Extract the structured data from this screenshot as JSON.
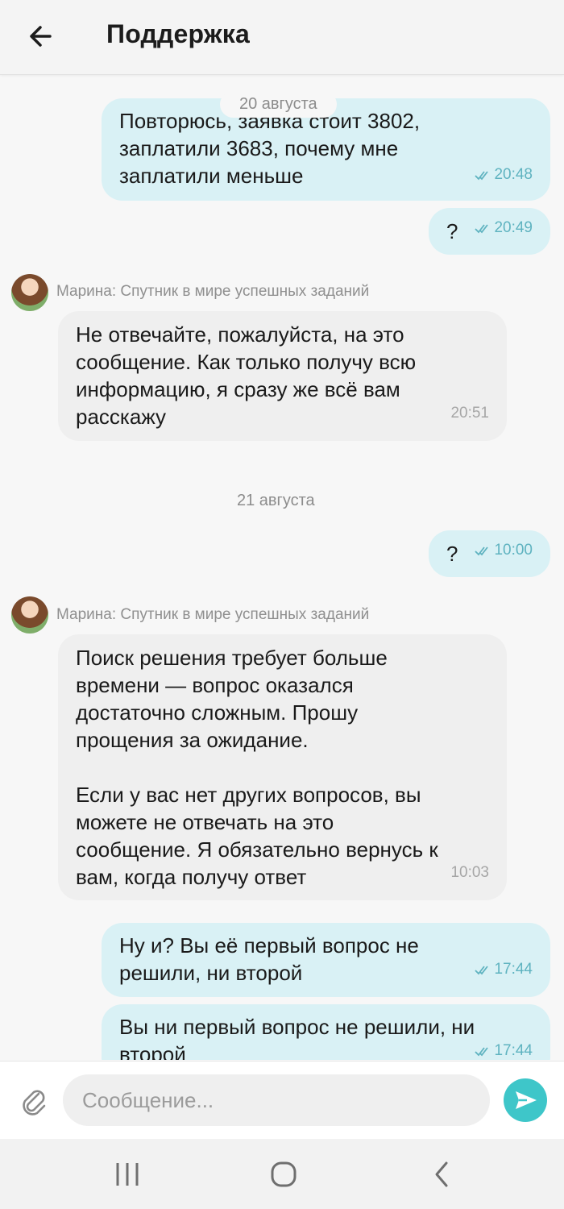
{
  "header": {
    "title": "Поддержка",
    "back_icon": "arrow-left-icon"
  },
  "messages": [
    {
      "dir": "out",
      "text": "Повторюсь, заявка стоит 3802,\nзаплатили 3683, почему мне\nзаплатили меньше",
      "time": "20:48"
    },
    {
      "dir": "out",
      "text": "?",
      "time": "20:49"
    },
    {
      "dir": "in",
      "sender": "Марина: Спутник в мире успешных заданий",
      "text": "Не отвечайте, пожалуйста, на это\nсообщение. Как только получу всю\nинформацию, я сразу же всё вам\nрасскажу",
      "time": "20:51"
    },
    {
      "dir": "out",
      "text": "?",
      "time": "10:00"
    },
    {
      "dir": "in",
      "sender": "Марина: Спутник в мире успешных заданий",
      "text": "Поиск решения требует больше\nвремени — вопрос оказался\nдостаточно сложным. Прошу\nпрощения за ожидание.\n\nЕсли у вас нет других вопросов, вы\nможете не отвечать на это\nсообщение. Я обязательно вернусь к\nвам, когда получу ответ",
      "time": "10:03"
    },
    {
      "dir": "out",
      "text": "Ну и? Вы её первый вопрос не\nрешили, ни второй",
      "time": "17:44"
    },
    {
      "dir": "out",
      "text": "Вы ни первый вопрос не решили, ни\nвторой",
      "time": "17:44"
    }
  ],
  "dates": [
    "20 августа",
    "21 августа"
  ],
  "composer": {
    "placeholder": "Сообщение...",
    "attach_icon": "paperclip-icon",
    "send_icon": "send-icon"
  },
  "colors": {
    "outgoing": "#d9f1f5",
    "incoming": "#efefef",
    "accent": "#3ec6c9",
    "time_out": "#5fb3c0"
  },
  "system_nav": {
    "recent_icon": "recent-apps-icon",
    "home_icon": "home-icon",
    "back_icon": "back-chevron-icon"
  }
}
